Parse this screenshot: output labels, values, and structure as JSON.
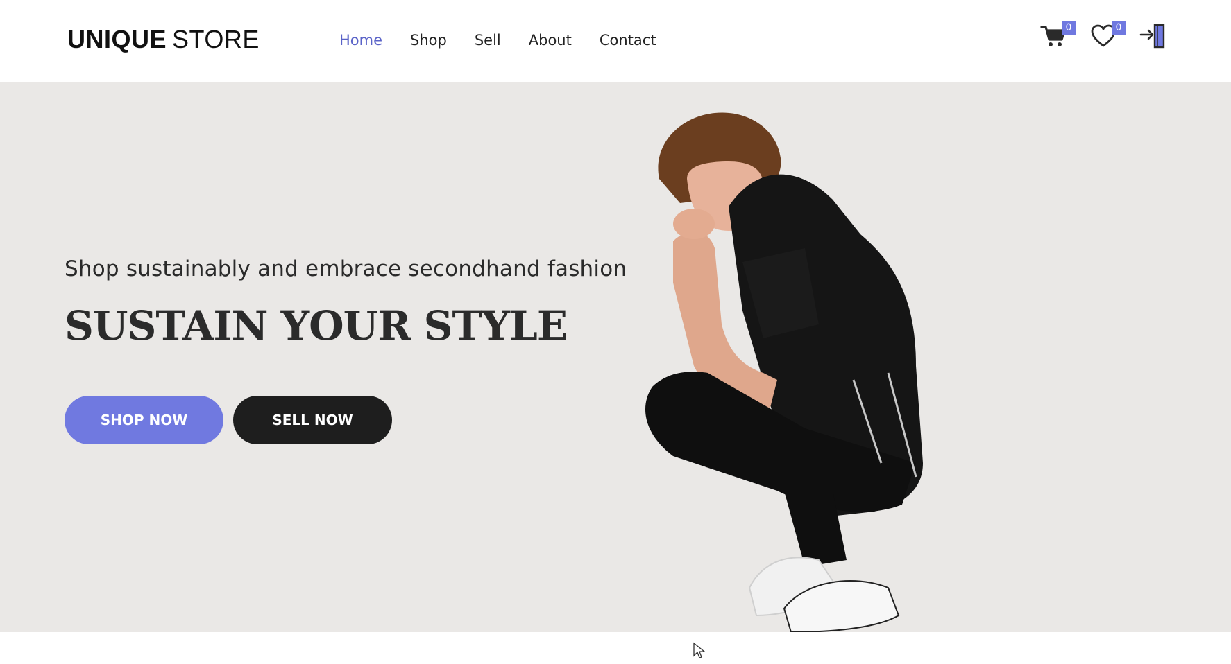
{
  "header": {
    "logo_bold": "UNIQUE",
    "logo_light": "STORE",
    "nav": [
      {
        "label": "Home",
        "active": true
      },
      {
        "label": "Shop",
        "active": false
      },
      {
        "label": "Sell",
        "active": false
      },
      {
        "label": "About",
        "active": false
      },
      {
        "label": "Contact",
        "active": false
      }
    ],
    "cart_count": "0",
    "wishlist_count": "0",
    "icons": [
      "cart-icon",
      "heart-icon",
      "login-icon"
    ]
  },
  "hero": {
    "subtitle": "Shop sustainably and embrace secondhand fashion",
    "title": "SUSTAIN YOUR STYLE",
    "shop_button": "SHOP NOW",
    "sell_button": "SELL NOW",
    "image": "model-image"
  },
  "colors": {
    "accent": "#7079e0",
    "nav_active": "#5a63c8",
    "hero_bg": "#eae8e6",
    "dark_button": "#1e1e1e"
  }
}
